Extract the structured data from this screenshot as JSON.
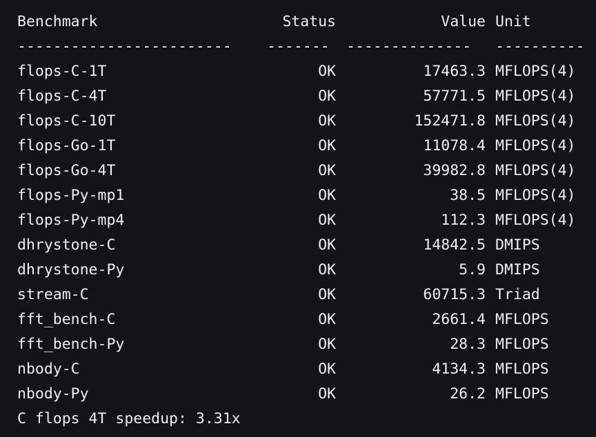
{
  "header": {
    "benchmark": "Benchmark",
    "status": "Status",
    "value": "Value",
    "unit": "Unit"
  },
  "separator": {
    "benchmark": "------------------------",
    "status": "-------",
    "value": "--------------",
    "unit": "----------"
  },
  "rows": [
    {
      "benchmark": "flops-C-1T",
      "status": "OK",
      "value": "17463.3",
      "unit": "MFLOPS(4)"
    },
    {
      "benchmark": "flops-C-4T",
      "status": "OK",
      "value": "57771.5",
      "unit": "MFLOPS(4)"
    },
    {
      "benchmark": "flops-C-10T",
      "status": "OK",
      "value": "152471.8",
      "unit": "MFLOPS(4)"
    },
    {
      "benchmark": "flops-Go-1T",
      "status": "OK",
      "value": "11078.4",
      "unit": "MFLOPS(4)"
    },
    {
      "benchmark": "flops-Go-4T",
      "status": "OK",
      "value": "39982.8",
      "unit": "MFLOPS(4)"
    },
    {
      "benchmark": "flops-Py-mp1",
      "status": "OK",
      "value": "38.5",
      "unit": "MFLOPS(4)"
    },
    {
      "benchmark": "flops-Py-mp4",
      "status": "OK",
      "value": "112.3",
      "unit": "MFLOPS(4)"
    },
    {
      "benchmark": "dhrystone-C",
      "status": "OK",
      "value": "14842.5",
      "unit": "DMIPS"
    },
    {
      "benchmark": "dhrystone-Py",
      "status": "OK",
      "value": "5.9",
      "unit": "DMIPS"
    },
    {
      "benchmark": "stream-C",
      "status": "OK",
      "value": "60715.3",
      "unit": "Triad"
    },
    {
      "benchmark": "fft_bench-C",
      "status": "OK",
      "value": "2661.4",
      "unit": "MFLOPS"
    },
    {
      "benchmark": "fft_bench-Py",
      "status": "OK",
      "value": "28.3",
      "unit": "MFLOPS"
    },
    {
      "benchmark": "nbody-C",
      "status": "OK",
      "value": "4134.3",
      "unit": "MFLOPS"
    },
    {
      "benchmark": "nbody-Py",
      "status": "OK",
      "value": "26.2",
      "unit": "MFLOPS"
    }
  ],
  "footer": {
    "text": "C flops 4T speedup: 3.31x"
  }
}
